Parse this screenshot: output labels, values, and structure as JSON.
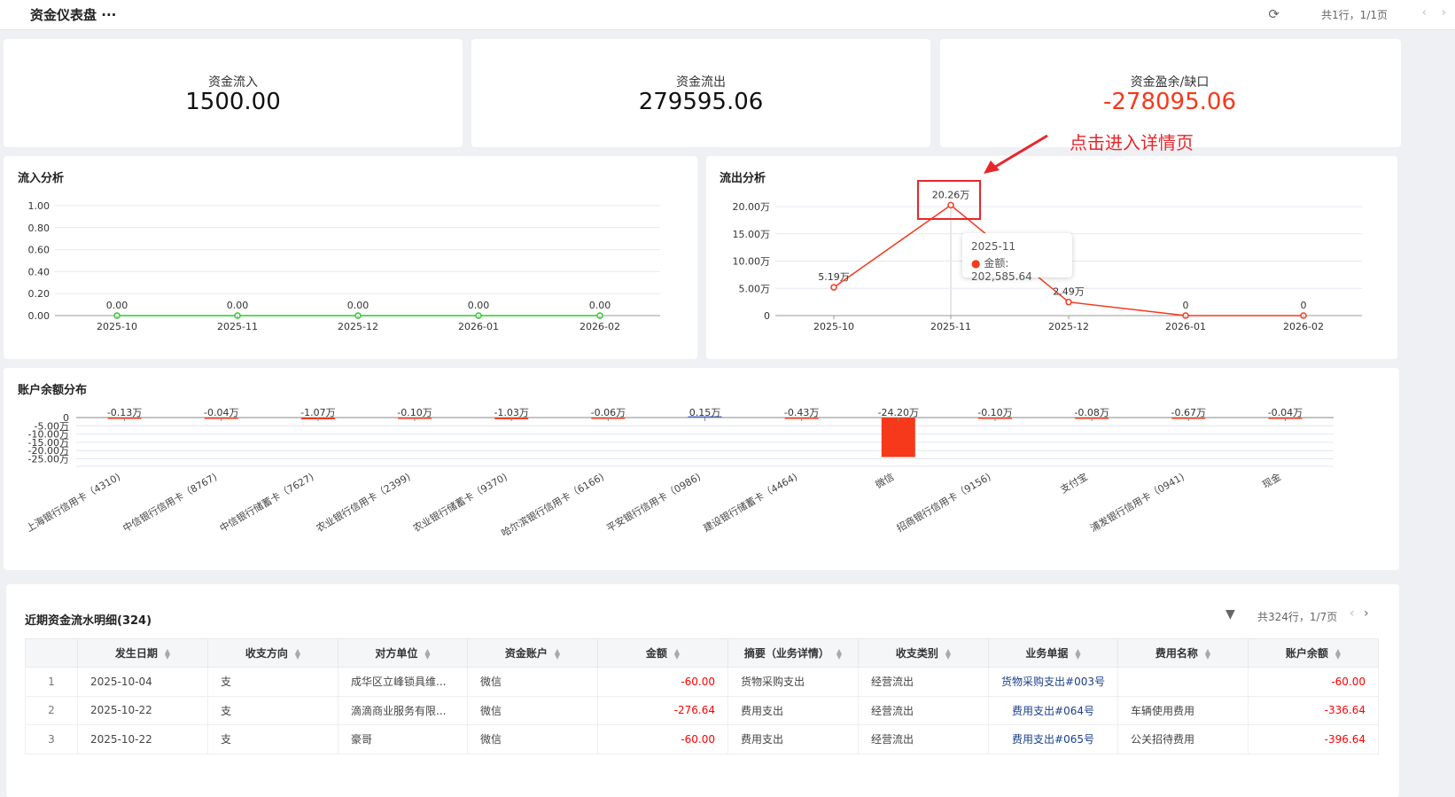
{
  "header": {
    "title": "资金仪表盘",
    "more": "···",
    "pager": "共1行，1/1页"
  },
  "kpis": [
    {
      "label": "资金流入",
      "value": "1500.00",
      "color": "#111111"
    },
    {
      "label": "资金流出",
      "value": "279595.06",
      "color": "#111111"
    },
    {
      "label": "资金盈余/缺口",
      "value": "-278095.06",
      "color": "#f5391a"
    }
  ],
  "annotation": {
    "text": "点击进入详情页",
    "color": "#e8262a"
  },
  "inflow": {
    "title": "流入分析",
    "chart_data": {
      "type": "line",
      "categories": [
        "2025-10",
        "2025-11",
        "2025-12",
        "2026-01",
        "2026-02"
      ],
      "values": [
        0,
        0,
        0,
        0,
        0
      ],
      "labels": [
        "0.00",
        "0.00",
        "0.00",
        "0.00",
        "0.00"
      ],
      "yticks": [
        "0.00",
        "0.20",
        "0.40",
        "0.60",
        "0.80",
        "1.00"
      ],
      "ylim": [
        0,
        1
      ],
      "color": "#2ecc2e",
      "grid": true
    }
  },
  "outflow": {
    "title": "流出分析",
    "chart_data": {
      "type": "line",
      "categories": [
        "2025-10",
        "2025-11",
        "2025-12",
        "2026-01",
        "2026-02"
      ],
      "values": [
        5.19,
        20.26,
        2.49,
        0,
        0
      ],
      "unit": "万",
      "labels": [
        "5.19万",
        "20.26万",
        "2.49万",
        "0",
        "0"
      ],
      "yticks": [
        "0",
        "5.00万",
        "10.00万",
        "15.00万",
        "20.00万"
      ],
      "ylim": [
        0,
        20
      ],
      "color": "#f5391a",
      "grid": true,
      "tooltip": {
        "title": "2025-11",
        "label": "金额: 202,585.64"
      }
    }
  },
  "accounts": {
    "title": "账户余额分布",
    "chart_data": {
      "type": "bar",
      "unit": "万",
      "categories": [
        "上海银行信用卡（4310)",
        "中信银行信用卡（8767)",
        "中信银行储蓄卡（7627)",
        "农业银行信用卡（2399)",
        "农业银行储蓄卡（9370)",
        "哈尔滨银行信用卡（6166)",
        "平安银行信用卡（0986)",
        "建设银行储蓄卡（4464)",
        "微信",
        "招商银行信用卡（9156)",
        "支付宝",
        "浦发银行信用卡（0941)",
        "现金"
      ],
      "values": [
        -0.13,
        -0.04,
        -1.07,
        -0.1,
        -1.03,
        -0.06,
        0.15,
        -0.43,
        -24.2,
        -0.1,
        -0.08,
        -0.67,
        -0.04
      ],
      "labels": [
        "-0.13万",
        "-0.04万",
        "-1.07万",
        "-0.10万",
        "-1.03万",
        "-0.06万",
        "0.15万",
        "-0.43万",
        "-24.20万",
        "-0.10万",
        "-0.08万",
        "-0.67万",
        "-0.04万"
      ],
      "yticks": [
        "0",
        "-5.00万",
        "-10.00万",
        "-15.00万",
        "-20.00万",
        "-25.00万"
      ],
      "ylim": [
        -25,
        0
      ],
      "neg_color": "#f5391a",
      "pos_color": "#5470c6",
      "grid": true
    }
  },
  "table": {
    "title": "近期资金流水明细(324)",
    "pager": "共324行，1/7页",
    "columns": [
      "",
      "发生日期",
      "收支方向",
      "对方单位",
      "资金账户",
      "金额",
      "摘要（业务详情）",
      "收支类别",
      "业务单据",
      "费用名称",
      "账户余额"
    ],
    "rows": [
      [
        "1",
        "2025-10-04",
        "支",
        "成华区立峰锁具维...",
        "微信",
        "-60.00",
        "货物采购支出",
        "经营流出",
        "货物采购支出#003号",
        "",
        "-60.00"
      ],
      [
        "2",
        "2025-10-22",
        "支",
        "滴滴商业服务有限...",
        "微信",
        "-276.64",
        "费用支出",
        "经营流出",
        "费用支出#064号",
        "车辆使用费用",
        "-336.64"
      ],
      [
        "3",
        "2025-10-22",
        "支",
        "豪哥",
        "微信",
        "-60.00",
        "费用支出",
        "经营流出",
        "费用支出#065号",
        "公关招待费用",
        "-396.64"
      ]
    ]
  }
}
